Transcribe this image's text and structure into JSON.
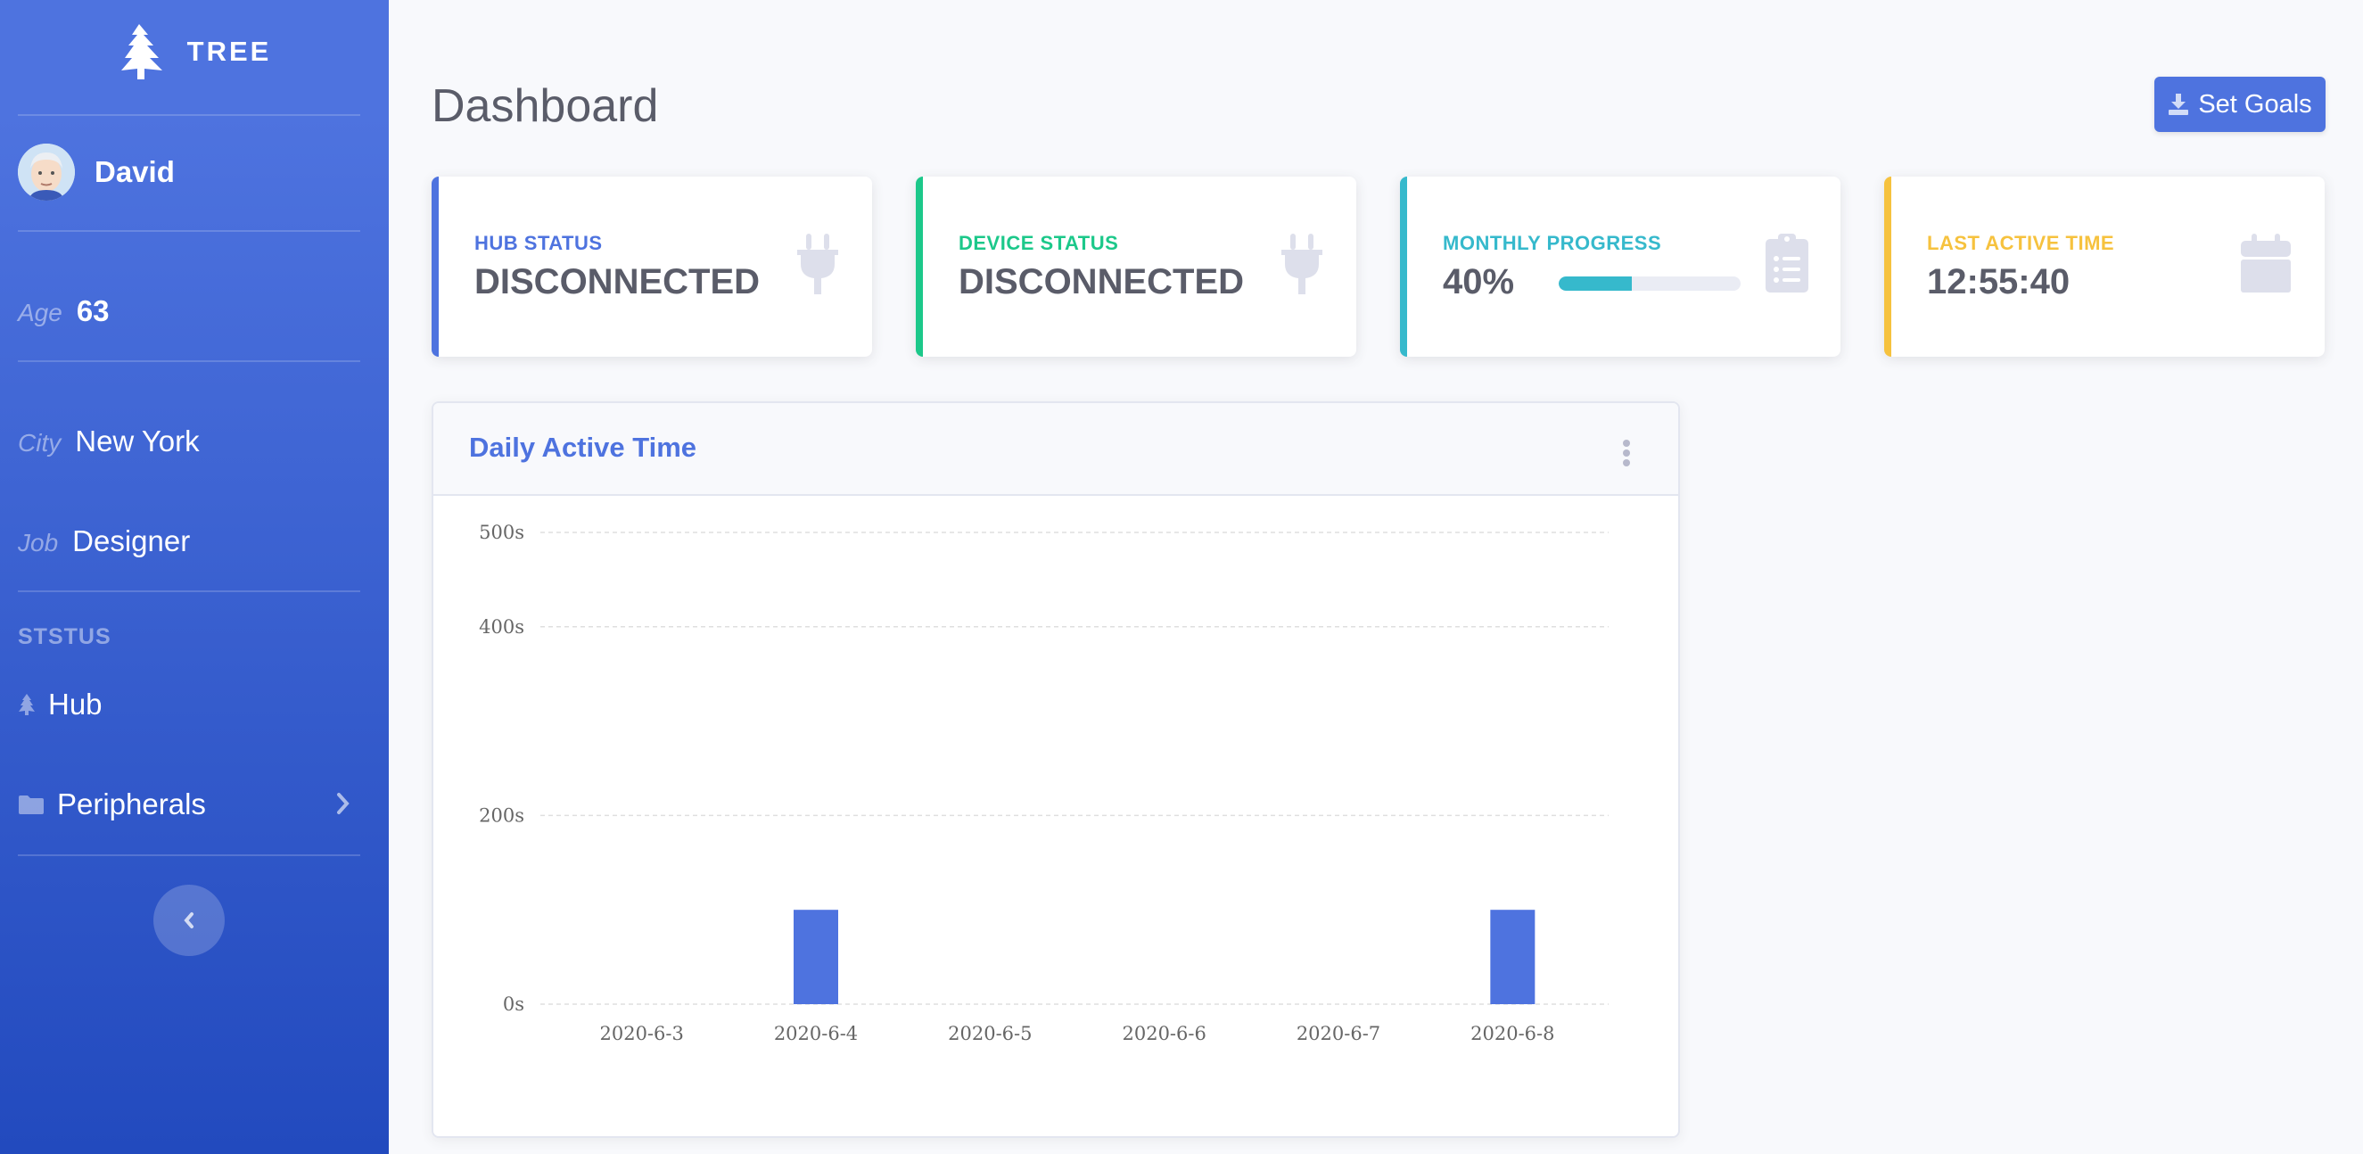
{
  "sidebar": {
    "brand": "TREE",
    "user_name": "David",
    "age_label": "Age",
    "age_value": "63",
    "city_label": "City",
    "city_value": "New York",
    "job_label": "Job",
    "job_value": "Designer",
    "section_heading": "STSTUS",
    "nav": [
      {
        "label": "Hub",
        "icon": "tree-icon"
      },
      {
        "label": "Peripherals",
        "icon": "folder-icon"
      }
    ]
  },
  "header": {
    "title": "Dashboard",
    "goals_button": "Set Goals"
  },
  "cards": [
    {
      "label": "HUB STATUS",
      "value": "DISCONNECTED",
      "color": "#4e73df",
      "icon": "plug-icon"
    },
    {
      "label": "DEVICE STATUS",
      "value": "DISCONNECTED",
      "color": "#1cc88a",
      "icon": "plug-icon"
    },
    {
      "label": "MONTHLY PROGRESS",
      "value": "40%",
      "progress": 0.4,
      "color": "#36b9cc",
      "icon": "clipboard-list-icon"
    },
    {
      "label": "LAST ACTIVE TIME",
      "value": "12:55:40",
      "color": "#f6c23e",
      "icon": "calendar-icon"
    }
  ],
  "chart_data": {
    "type": "bar",
    "title": "Daily Active Time",
    "categories": [
      "2020-6-3",
      "2020-6-4",
      "2020-6-5",
      "2020-6-6",
      "2020-6-7",
      "2020-6-8"
    ],
    "values": [
      0,
      100,
      0,
      0,
      0,
      100
    ],
    "yticks": [
      0,
      200,
      400,
      500
    ],
    "ytick_labels": [
      "0s",
      "200s",
      "400s",
      "500s"
    ],
    "ylim": [
      0,
      500
    ],
    "grid": true,
    "color": "#4e73df"
  }
}
